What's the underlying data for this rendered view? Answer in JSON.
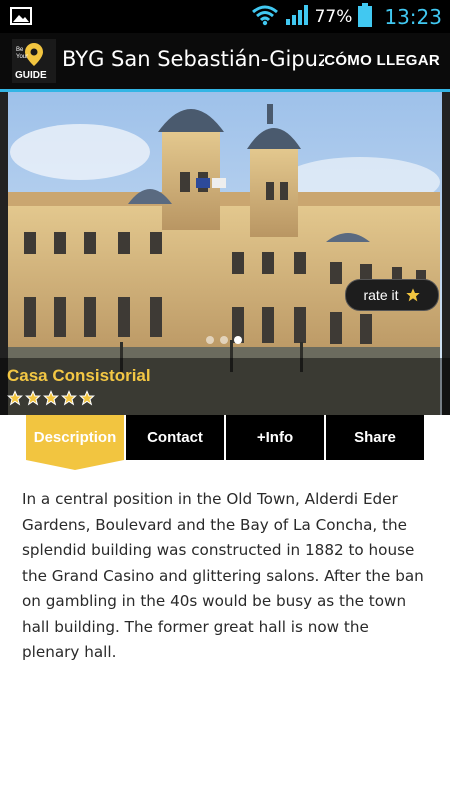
{
  "status_bar": {
    "battery_percent": "77%",
    "time": "13:23",
    "time_color": "#41c8f1",
    "icons": [
      "image-icon",
      "wifi-icon",
      "signal-icon",
      "battery-icon"
    ]
  },
  "app_bar": {
    "logo_text_top": "Be Your",
    "logo_text_bottom": "GUIDE",
    "title": "BYG San Sebastián-Gipuzkoa",
    "action_label": "CÓMO LLEGAR",
    "accent_color": "#33b5e5"
  },
  "hero": {
    "place_name": "Casa Consistorial",
    "rating_stars": 5,
    "rate_label": "rate it",
    "carousel_pages": 3,
    "carousel_active": 3
  },
  "tabs": [
    {
      "label": "Description",
      "active": true
    },
    {
      "label": "Contact",
      "active": false
    },
    {
      "label": "+Info",
      "active": false
    },
    {
      "label": "Share",
      "active": false
    }
  ],
  "description": "In a central position in the Old Town, Alderdi Eder Gardens, Boulevard and the Bay of La Concha, the splendid building was constructed in 1882 to house the Grand Casino and glittering salons. After the ban on gambling in the 40s would be busy as the town hall building. The former great hall is now the plenary hall.",
  "colors": {
    "tab_active": "#f2c540",
    "place_name": "#f3c744"
  }
}
